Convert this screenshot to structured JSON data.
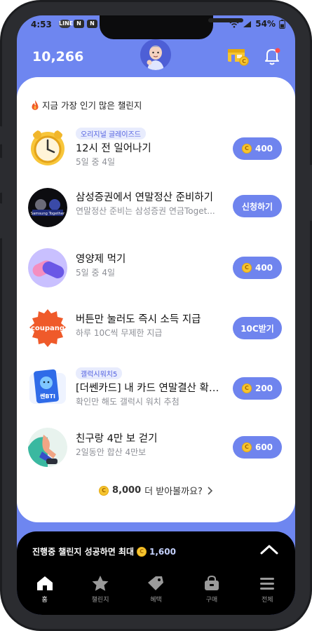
{
  "status": {
    "time": "4:53",
    "battery": "54%",
    "left_badges": [
      "LINE",
      "N",
      "N"
    ]
  },
  "header": {
    "points": "10,266"
  },
  "section": {
    "title": "지금 가장 인기 많은 챌린지"
  },
  "challenges": [
    {
      "badge": "오리지널 글레이즈드",
      "title": "12시 전 일어나기",
      "sub": "5일 중 4일",
      "button": "400",
      "button_type": "coin"
    },
    {
      "badge": "",
      "title": "삼성증권에서 연말정산 준비하기",
      "sub": "연말정산 준비는 삼성증권 연금Toget...",
      "button": "신청하기",
      "button_type": "text"
    },
    {
      "badge": "",
      "title": "영양제 먹기",
      "sub": "5일 중 4일",
      "button": "400",
      "button_type": "coin"
    },
    {
      "badge": "",
      "title": "버튼만 눌러도 즉시 소득 지급",
      "sub": "하루 10C씩 무제한 지급",
      "button": "10C받기",
      "button_type": "text"
    },
    {
      "badge": "갤럭시워치5",
      "title": "[더쎈카드] 내 카드 연말결산 확인하기",
      "sub": "확인만 해도 갤럭시 워치 추첨",
      "button": "200",
      "button_type": "coin"
    },
    {
      "badge": "",
      "title": "친구랑 4만 보 걷기",
      "sub": "2일동안 합산 4만보",
      "button": "600",
      "button_type": "coin"
    }
  ],
  "thumb_labels": {
    "coupang": "coupang",
    "card": "쎈BTI",
    "samsung": "Samsung Together"
  },
  "more": {
    "amount": "8,000",
    "text": "더 받아볼까요?"
  },
  "promo": {
    "text": "진행중 챌린지 성공하면 최대",
    "amount": "1,600"
  },
  "nav": [
    {
      "label": "홈",
      "icon": "home-icon",
      "active": true
    },
    {
      "label": "챌린지",
      "icon": "star-icon",
      "active": false
    },
    {
      "label": "혜택",
      "icon": "tag-icon",
      "active": false
    },
    {
      "label": "구매",
      "icon": "bag-icon",
      "active": false
    },
    {
      "label": "전체",
      "icon": "menu-icon",
      "active": false
    }
  ],
  "colors": {
    "accent": "#6f84ee",
    "header_bg": "#6e86f0",
    "coin": "#f6c531"
  }
}
